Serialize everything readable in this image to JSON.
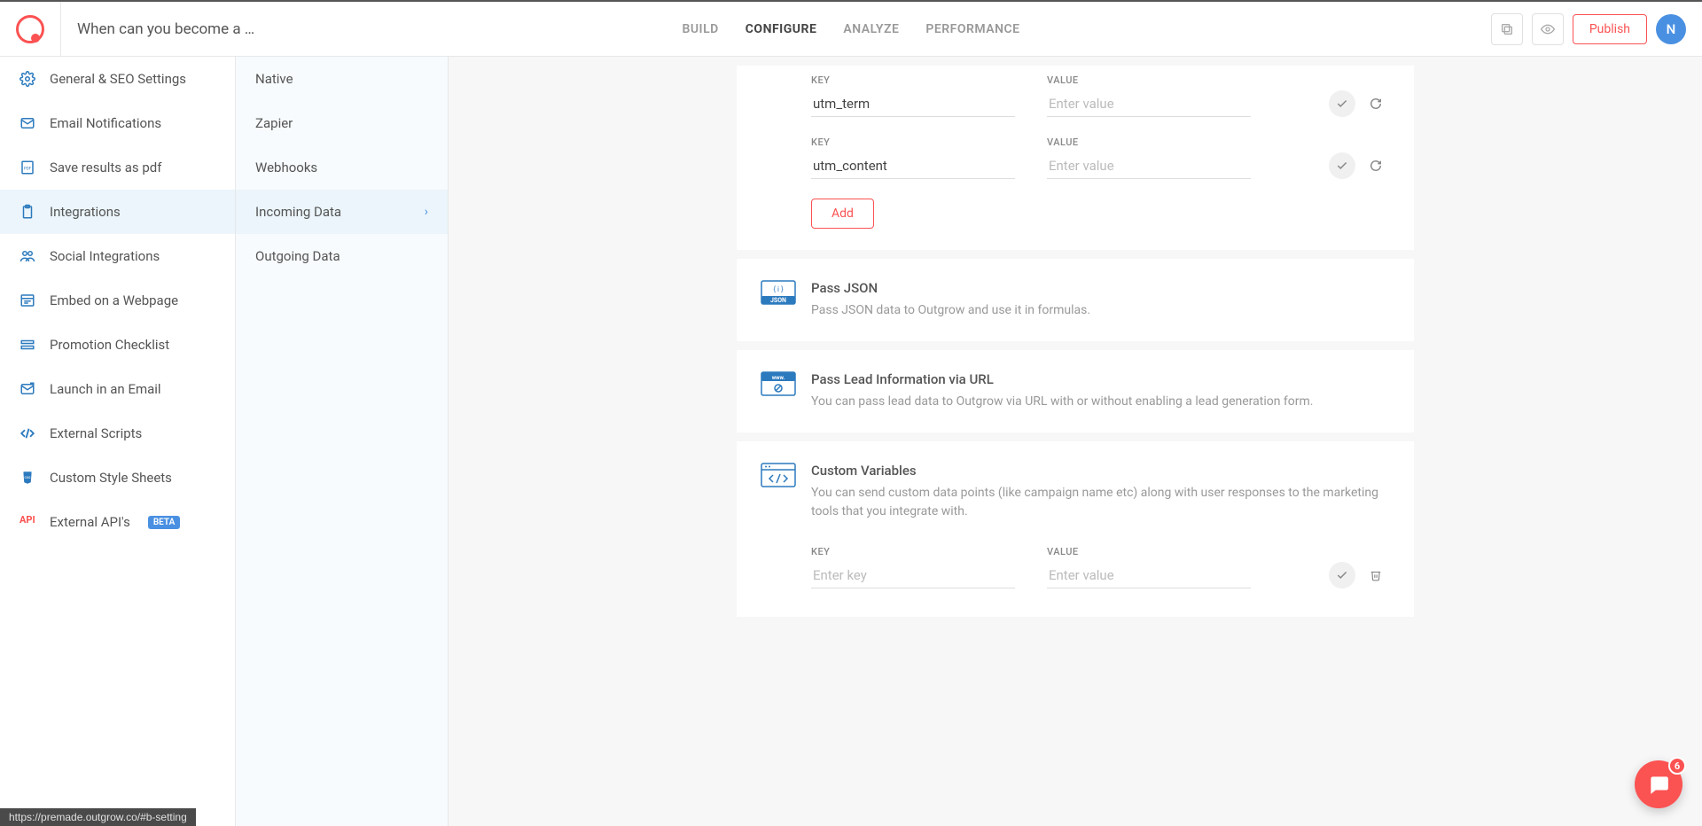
{
  "header": {
    "title": "When can you become a …",
    "nav": [
      {
        "label": "BUILD",
        "active": false
      },
      {
        "label": "CONFIGURE",
        "active": true
      },
      {
        "label": "ANALYZE",
        "active": false
      },
      {
        "label": "PERFORMANCE",
        "active": false
      }
    ],
    "publish_label": "Publish",
    "avatar_letter": "N"
  },
  "sidebar1": [
    {
      "label": "General & SEO Settings",
      "icon": "gear"
    },
    {
      "label": "Email Notifications",
      "icon": "mail"
    },
    {
      "label": "Save results as pdf",
      "icon": "pdf"
    },
    {
      "label": "Integrations",
      "icon": "clipboard",
      "active": true
    },
    {
      "label": "Social Integrations",
      "icon": "people"
    },
    {
      "label": "Embed on a Webpage",
      "icon": "embed"
    },
    {
      "label": "Promotion Checklist",
      "icon": "checklist"
    },
    {
      "label": "Launch in an Email",
      "icon": "launch-mail"
    },
    {
      "label": "External Scripts",
      "icon": "code"
    },
    {
      "label": "Custom Style Sheets",
      "icon": "css"
    },
    {
      "label": "External API's",
      "icon": "api",
      "beta": "BETA"
    }
  ],
  "sidebar2": [
    {
      "label": "Native"
    },
    {
      "label": "Zapier"
    },
    {
      "label": "Webhooks"
    },
    {
      "label": "Incoming Data",
      "active": true,
      "chevron": true
    },
    {
      "label": "Outgoing Data"
    }
  ],
  "utm_rows": [
    {
      "key": "utm_term",
      "value": ""
    },
    {
      "key": "utm_content",
      "value": ""
    }
  ],
  "labels": {
    "key": "KEY",
    "value": "VALUE",
    "add": "Add",
    "enter_key": "Enter key",
    "enter_value": "Enter value"
  },
  "sections": {
    "json": {
      "title": "Pass JSON",
      "desc": "Pass JSON data to Outgrow and use it in formulas."
    },
    "lead": {
      "title": "Pass Lead Information via URL",
      "desc": "You can pass lead data to Outgrow via URL with or without enabling a lead generation form."
    },
    "custom": {
      "title": "Custom Variables",
      "desc": "You can send custom data points (like campaign name etc) along with user responses to the marketing tools that you integrate with."
    }
  },
  "custom_rows": [
    {
      "key": "",
      "value": ""
    }
  ],
  "status_url": "https://premade.outgrow.co/#b-setting",
  "chat_badge": "6"
}
